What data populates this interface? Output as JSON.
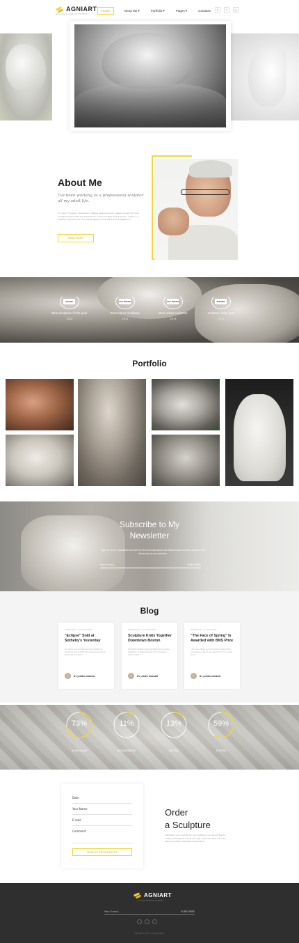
{
  "header": {
    "logo_text": "AGNIART",
    "tagline": "Art and Sculpture Portfolio",
    "nav": [
      "Home",
      "About Me",
      "Portfolio",
      "Pages",
      "Contacts"
    ],
    "social_icons": [
      "twitter-icon",
      "facebook-icon",
      "instagram-icon"
    ]
  },
  "about": {
    "title": "About Me",
    "subtitle": "I've been working as a professional sculptor all my adult life.",
    "text": "For over 25 years I have been creating award-winning classic bronze and clay sculpture works that are exhibited in advanced New York galleries. I work in a variety of genres and can always apply to new ideas and suggestions.",
    "button": "READ MORE"
  },
  "awards": [
    {
      "badge": "AWARD",
      "label": "Best sculpture of the year",
      "year": "2010"
    },
    {
      "badge": "TOP AWARD",
      "label": "Best nature sculpture",
      "year": "2011"
    },
    {
      "badge": "TOP AWARD",
      "label": "Best urban sculpture",
      "year": "2013"
    },
    {
      "badge": "WINNER",
      "label": "Sculptor of the year",
      "year": "2016"
    }
  ],
  "portfolio": {
    "title": "Portfolio"
  },
  "newsletter": {
    "title_line1": "Subscribe to My",
    "title_line2": "Newsletter",
    "text": "Sign up to my newsletter and be the first to know about the latest news, events, updates and discounts on my services.",
    "placeholder": "Your E-mail...",
    "button": "SUBSCRIBE"
  },
  "blog": {
    "title": "Blog",
    "posts": [
      {
        "meta": "12.05.2017  •  0 comments",
        "title": "\"Eclipse\" Sold at Sotheby's Yesterday",
        "excerpt": "So happy and proud to announce that my sculpture was sold for the estimated price at yesterday's auction...",
        "author": "BY JAMES PARKER"
      },
      {
        "meta": "26.05.2017  •  0 comments",
        "title": "Sculpture Knits Together Downtown Boston",
        "excerpt": "Downtown Boston was the setting for an open exhibition in the Art Center. The \"Sculpture Knits\" event...",
        "author": "BY JAMES PARKER"
      },
      {
        "meta": "30.5.2017  •  0 comments",
        "title": "\"The Face of Spring\" Is Awarded with BNS Prize",
        "excerpt": "I am very happy and honored to receive this prestigious prize. It was awarded to my recent work...",
        "author": "BY JAMES PARKER"
      }
    ]
  },
  "stats": [
    {
      "value": "73%",
      "fraction": 0.73,
      "label": "3D MODELING"
    },
    {
      "value": "11%",
      "fraction": 0.11,
      "label": "WOODWORKING"
    },
    {
      "value": "13%",
      "fraction": 0.13,
      "label": "CASTING"
    },
    {
      "value": "59%",
      "fraction": 0.59,
      "label": "FORGING"
    }
  ],
  "order": {
    "fields": [
      "Date",
      "Your Name",
      "E-mail",
      "Comment"
    ],
    "button": "MAKE AN APPOINTMENT",
    "title_line1": "Order",
    "title_line2": "a Sculpture",
    "text": "I will send you a quote for any sculpture you would like to make including the initial concept, materials that could be used and other important information."
  },
  "footer": {
    "logo_text": "AGNIART",
    "tagline": "Art and Sculpture Portfolio",
    "placeholder": "Your E-mail...",
    "button": "SUBSCRIBE",
    "copyright": "AgniArt © 2017. Privacy Policy"
  },
  "colors": {
    "accent": "#f3d633",
    "footer_bg": "#2f2f2f"
  }
}
